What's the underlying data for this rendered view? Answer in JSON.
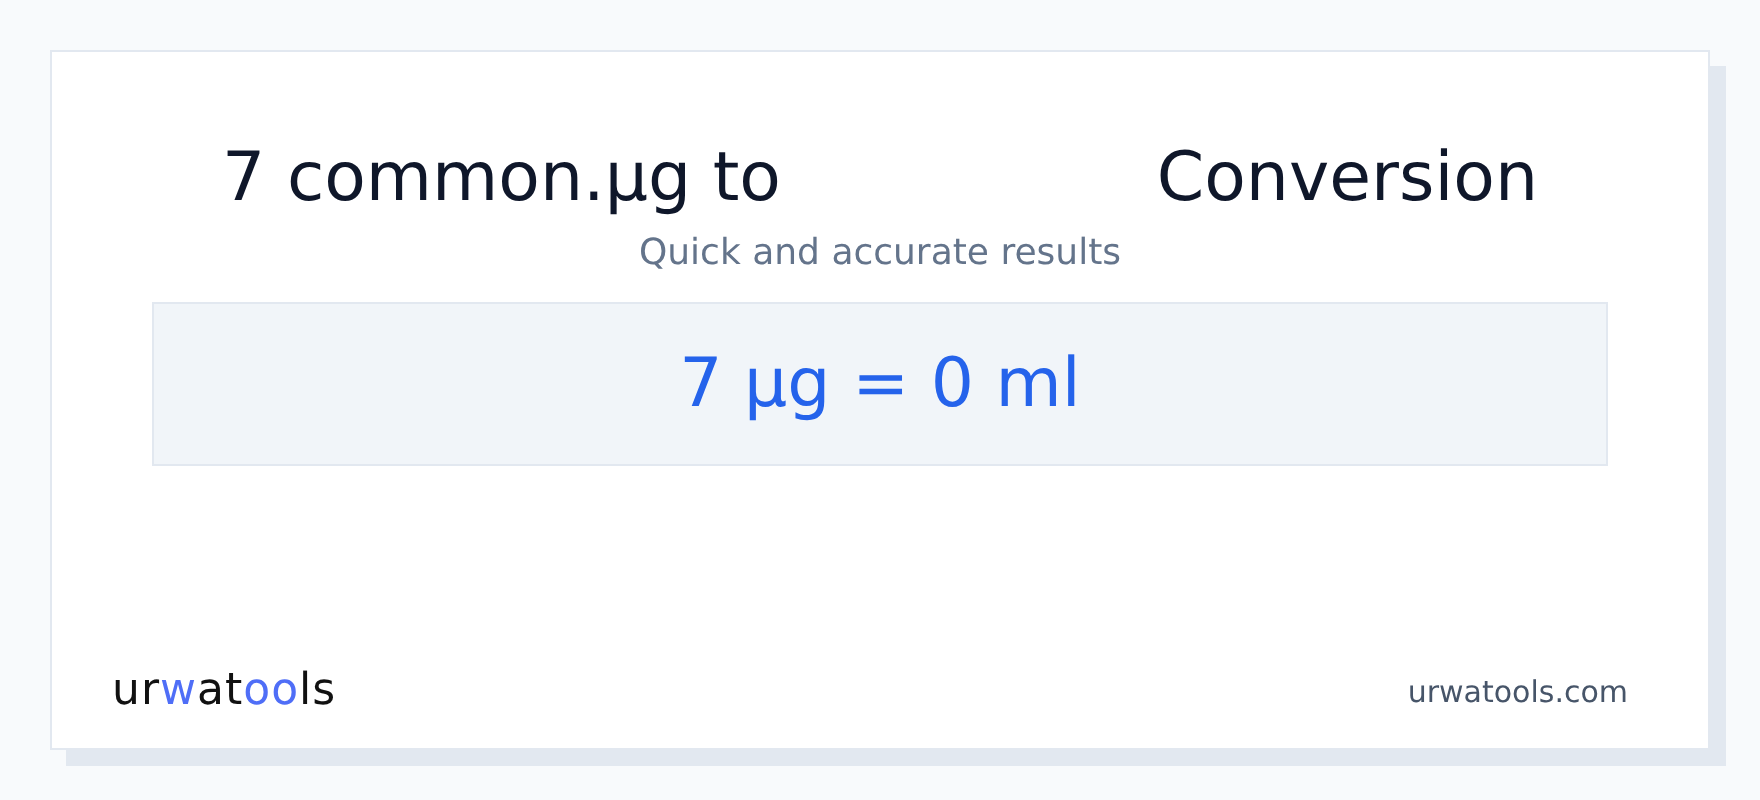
{
  "title": {
    "left": "7 common.µg to",
    "right": "Conversion"
  },
  "subtitle": "Quick and accurate results",
  "result": "7 µg = 0 ml",
  "logo": [
    {
      "text": "ur",
      "accent": false
    },
    {
      "text": "w",
      "accent": true
    },
    {
      "text": "at",
      "accent": false
    },
    {
      "text": "oo",
      "accent": true
    },
    {
      "text": "ls",
      "accent": false
    }
  ],
  "site": "urwatools.com"
}
